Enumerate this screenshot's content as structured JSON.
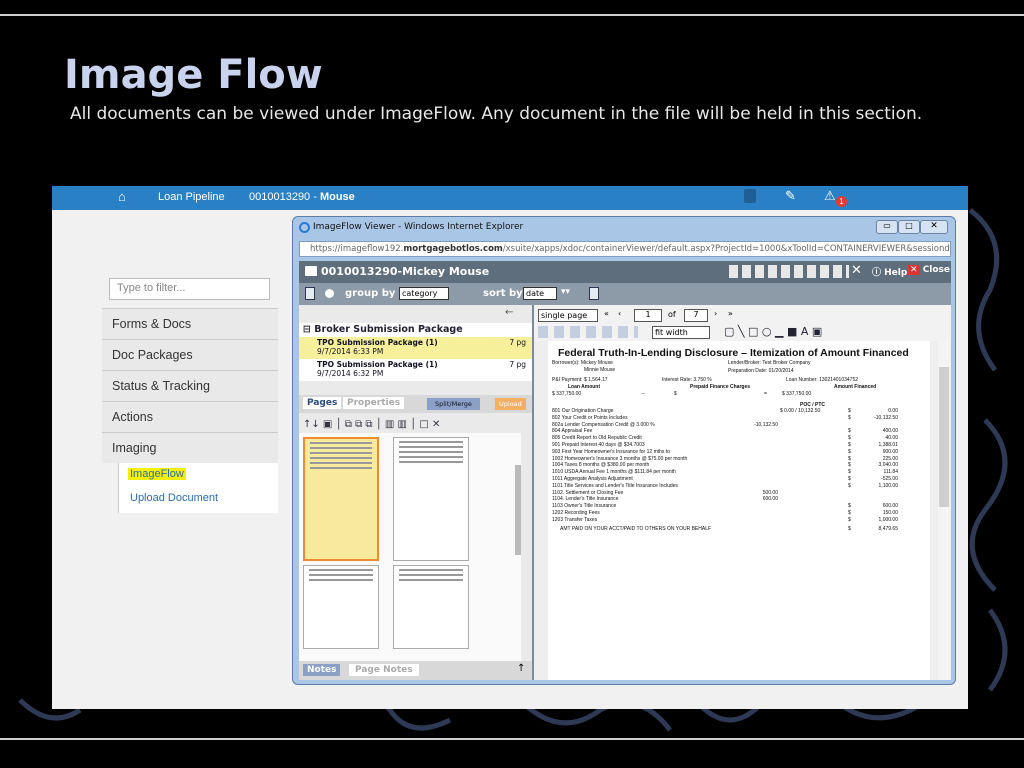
{
  "slide": {
    "title": "Image Flow",
    "subtitle": "All documents can be viewed under ImageFlow.  Any document in the file will be held in this section."
  },
  "appbar": {
    "home_icon": "home-icon",
    "pipeline": "Loan Pipeline",
    "loan_prefix": "0010013290 - ",
    "loan_name": "Mouse",
    "alert_count": "1"
  },
  "sidebar": {
    "filter_placeholder": "Type to filter...",
    "items": [
      "Forms & Docs",
      "Doc Packages",
      "Status & Tracking",
      "Actions",
      "Imaging"
    ],
    "sub_items": [
      "ImageFlow",
      "Upload Document"
    ]
  },
  "window": {
    "title": "ImageFlow Viewer - Windows Internet Explorer",
    "url_a": "https://imageflow192.",
    "url_b": "mortgagebotlos.com",
    "url_c": "/xsuite/xapps/xdoc/containerViewer/default.aspx?ProjectId=1000&xToolId=CONTAINERVIEWER&sessiondata="
  },
  "viewer": {
    "file_title": "0010013290-Mickey Mouse",
    "help": "Help",
    "close": "Close",
    "group_by": "group by",
    "group_value": "category",
    "sort_by": "sort by",
    "sort_value": "date"
  },
  "tree": {
    "group": "Broker Submission Package",
    "items": [
      {
        "title": "TPO Submission Package (1)",
        "date": "9/7/2014 6:33 PM",
        "pages": "7 pg"
      },
      {
        "title": "TPO Submission Package (1)",
        "date": "9/7/2014 6:32 PM",
        "pages": "7 pg"
      }
    ]
  },
  "tabs": {
    "pages": "Pages",
    "properties": "Properties",
    "split": "Split/Merge",
    "upload": "Upload",
    "notes": "Notes",
    "page_notes": "Page Notes"
  },
  "pager": {
    "mode": "single page",
    "current": "1",
    "of": "of",
    "total": "7",
    "zoom": "fit width"
  },
  "document": {
    "title": "Federal Truth-In-Lending Disclosure – Itemization of Amount Financed",
    "borrowers_label": "Borrower(s):",
    "borrower1": "Mickey Mouse",
    "borrower2": "Minnie Mouse",
    "lender_label": "Lender/Broker:",
    "lender": "Test Broker Company",
    "prep_label": "Preparation Date:",
    "prep_date": "01/20/2014",
    "pi": "P&I Payment: $ 1,564.17",
    "rate": "Interest Rate: 3.750 %",
    "loan_no": "Loan Number: 13021401034752",
    "h_loan": "Loan Amount",
    "h_prepaid": "Prepaid Finance Charges",
    "h_financed": "Amount Financed",
    "loan_amt": "$ 337,750.00",
    "dash": "–",
    "dollar": "$",
    "eq": "=",
    "financed_amt": "$  337,750.00",
    "poc": "POC / PTC",
    "lines": [
      {
        "d": "801  Our Origination Charge",
        "a": "",
        "p": "$        0.00 / 10,132.50",
        "t": "0.00"
      },
      {
        "d": "802  Your Credit or Points Includes",
        "a": "",
        "p": "",
        "t": "-10,132.50"
      },
      {
        "d": "      802a  Lender Compensation Credit @ 3.000 %",
        "a": "-10,132.50",
        "p": "",
        "t": ""
      },
      {
        "d": "804  Appraisal Fee",
        "a": "",
        "p": "",
        "t": "400.00"
      },
      {
        "d": "805  Credit Report to Old Republic Credit",
        "a": "",
        "p": "",
        "t": "40.00"
      },
      {
        "d": "901  Prepaid Interest 40 days @ $34.7003",
        "a": "",
        "p": "",
        "t": "1,388.01"
      },
      {
        "d": "903  First Year Homeowner's Insurance for 12 mths to",
        "a": "",
        "p": "",
        "t": "900.00"
      },
      {
        "d": "1002  Homeowner's Insurance 3 months @ $75.00 per month",
        "a": "",
        "p": "",
        "t": "225.00"
      },
      {
        "d": "1004  Taxes 8 months @ $380.00 per month",
        "a": "",
        "p": "",
        "t": "3,040.00"
      },
      {
        "d": "1010  USDA Annual Fee 1 months @ $111.84 per month",
        "a": "",
        "p": "",
        "t": "111.84"
      },
      {
        "d": "1011  Aggregate Analysis Adjustment",
        "a": "",
        "p": "",
        "t": "-525.00"
      },
      {
        "d": "1101  Title Services and Lender's Title Insurance Includes",
        "a": "",
        "p": "",
        "t": "1,100.00"
      },
      {
        "d": "        1102.  Settlement or Closing Fee",
        "a": "500.00",
        "p": "",
        "t": ""
      },
      {
        "d": "        1104.  Lender's Title Insurance",
        "a": "600.00",
        "p": "",
        "t": ""
      },
      {
        "d": "1103  Owner's Title Insurance",
        "a": "",
        "p": "",
        "t": "600.00"
      },
      {
        "d": "1202  Recording Fees",
        "a": "",
        "p": "",
        "t": "150.00"
      },
      {
        "d": "1203  Transfer Taxes",
        "a": "",
        "p": "",
        "t": "1,000.00"
      }
    ],
    "amt_paid": "AMT PAID ON YOUR ACCT/PAID TO OTHERS ON YOUR BEHALF",
    "amt_total": "8,479.65"
  }
}
